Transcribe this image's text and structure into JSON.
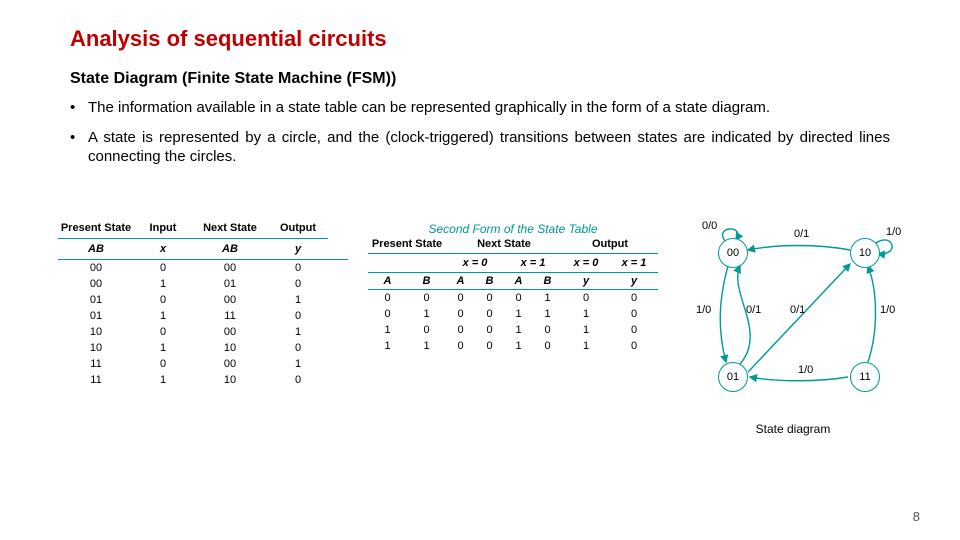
{
  "title": "Analysis of sequential circuits",
  "subtitle": "State Diagram (Finite State Machine (FSM))",
  "bullet1": "The information available in a state table can be represented graphically in the form of a state diagram.",
  "bullet2": "A state is represented by a circle, and the (clock-triggered) transitions between states are indicated by directed lines connecting the circles.",
  "page_number": "8",
  "t1": {
    "h_present": "Present State",
    "h_input": "Input",
    "h_next": "Next State",
    "h_output": "Output",
    "sub_A": "A",
    "sub_B": "B",
    "sub_x": "x",
    "sub_y": "y",
    "rows": [
      {
        "A": "0",
        "B": "0",
        "x": "0",
        "nA": "0",
        "nB": "0",
        "y": "0"
      },
      {
        "A": "0",
        "B": "0",
        "x": "1",
        "nA": "0",
        "nB": "1",
        "y": "0"
      },
      {
        "A": "0",
        "B": "1",
        "x": "0",
        "nA": "0",
        "nB": "0",
        "y": "1"
      },
      {
        "A": "0",
        "B": "1",
        "x": "1",
        "nA": "1",
        "nB": "1",
        "y": "0"
      },
      {
        "A": "1",
        "B": "0",
        "x": "0",
        "nA": "0",
        "nB": "0",
        "y": "1"
      },
      {
        "A": "1",
        "B": "0",
        "x": "1",
        "nA": "1",
        "nB": "0",
        "y": "0"
      },
      {
        "A": "1",
        "B": "1",
        "x": "0",
        "nA": "0",
        "nB": "0",
        "y": "1"
      },
      {
        "A": "1",
        "B": "1",
        "x": "1",
        "nA": "1",
        "nB": "0",
        "y": "0"
      }
    ]
  },
  "t2": {
    "title": "Second Form of the State Table",
    "h_present": "Present State",
    "h_next": "Next State",
    "h_output": "Output",
    "x0": "x = 0",
    "x1": "x = 1",
    "A": "A",
    "B": "B",
    "y": "y",
    "rows": [
      {
        "A": "0",
        "B": "0",
        "nA0": "0",
        "nB0": "0",
        "nA1": "0",
        "nB1": "1",
        "y0": "0",
        "y1": "0"
      },
      {
        "A": "0",
        "B": "1",
        "nA0": "0",
        "nB0": "0",
        "nA1": "1",
        "nB1": "1",
        "y0": "1",
        "y1": "0"
      },
      {
        "A": "1",
        "B": "0",
        "nA0": "0",
        "nB0": "0",
        "nA1": "1",
        "nB1": "0",
        "y0": "1",
        "y1": "0"
      },
      {
        "A": "1",
        "B": "1",
        "nA0": "0",
        "nB0": "0",
        "nA1": "1",
        "nB1": "0",
        "y0": "1",
        "y1": "0"
      }
    ]
  },
  "sd": {
    "n00": "00",
    "n01": "01",
    "n10": "10",
    "n11": "11",
    "e00_self": "0/0",
    "e00_01": "1/0",
    "e10_00": "0/1",
    "e10_self": "1/0",
    "e01_00": "0/1",
    "e01_11": "0/1",
    "e11_10": "1/0",
    "e11_01": "1/0",
    "caption": "State diagram"
  }
}
